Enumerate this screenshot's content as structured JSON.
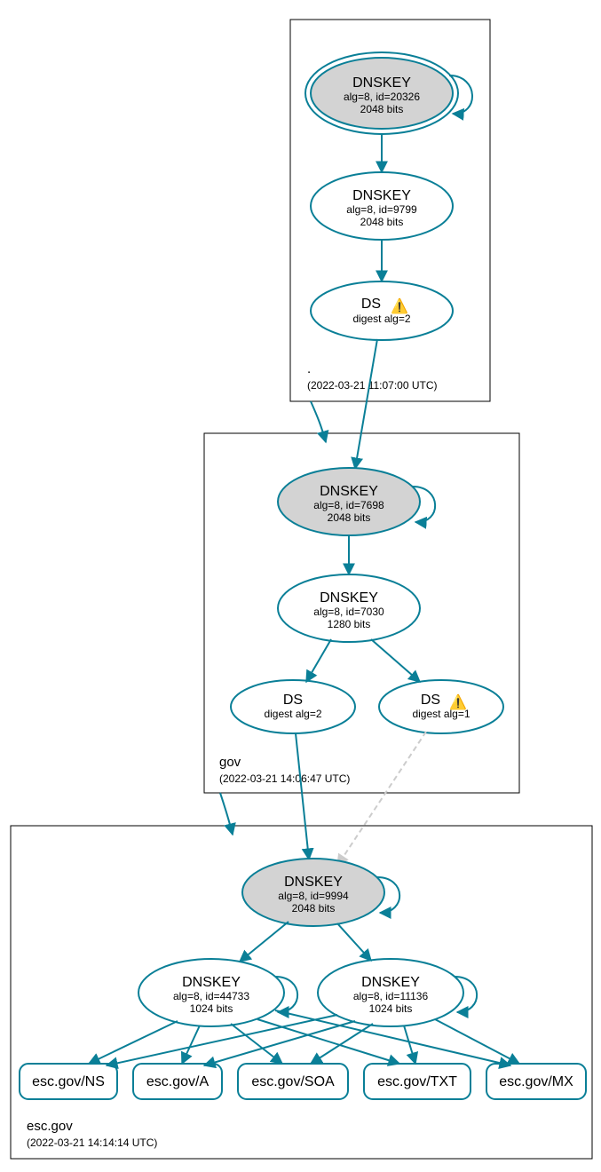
{
  "colors": {
    "accent": "#0a7f97",
    "trust_fill": "#d3d3d3",
    "dashed": "#cccccc"
  },
  "zones": {
    "root": {
      "name": ".",
      "timestamp": "(2022-03-21 11:07:00 UTC)"
    },
    "gov": {
      "name": "gov",
      "timestamp": "(2022-03-21 14:06:47 UTC)"
    },
    "esc": {
      "name": "esc.gov",
      "timestamp": "(2022-03-21 14:14:14 UTC)"
    }
  },
  "nodes": {
    "root_ksk": {
      "title": "DNSKEY",
      "line2": "alg=8, id=20326",
      "line3": "2048 bits"
    },
    "root_zsk": {
      "title": "DNSKEY",
      "line2": "alg=8, id=9799",
      "line3": "2048 bits"
    },
    "root_ds": {
      "title": "DS",
      "line2": "digest alg=2",
      "warn": true
    },
    "gov_ksk": {
      "title": "DNSKEY",
      "line2": "alg=8, id=7698",
      "line3": "2048 bits"
    },
    "gov_zsk": {
      "title": "DNSKEY",
      "line2": "alg=8, id=7030",
      "line3": "1280 bits"
    },
    "gov_ds1": {
      "title": "DS",
      "line2": "digest alg=2"
    },
    "gov_ds2": {
      "title": "DS",
      "line2": "digest alg=1",
      "warn": true
    },
    "esc_ksk": {
      "title": "DNSKEY",
      "line2": "alg=8, id=9994",
      "line3": "2048 bits"
    },
    "esc_zsk1": {
      "title": "DNSKEY",
      "line2": "alg=8, id=44733",
      "line3": "1024 bits"
    },
    "esc_zsk2": {
      "title": "DNSKEY",
      "line2": "alg=8, id=11136",
      "line3": "1024 bits"
    }
  },
  "records": {
    "ns": "esc.gov/NS",
    "a": "esc.gov/A",
    "soa": "esc.gov/SOA",
    "txt": "esc.gov/TXT",
    "mx": "esc.gov/MX"
  }
}
